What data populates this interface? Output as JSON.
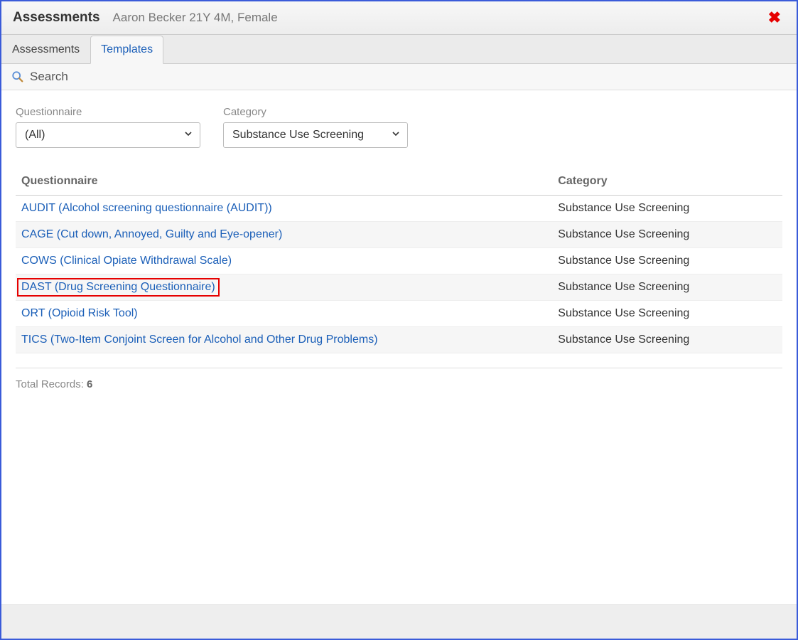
{
  "header": {
    "title": "Assessments",
    "patient": "Aaron Becker 21Y 4M, Female"
  },
  "tabs": [
    {
      "label": "Assessments",
      "active": false
    },
    {
      "label": "Templates",
      "active": true
    }
  ],
  "search_label": "Search",
  "filters": {
    "questionnaire": {
      "label": "Questionnaire",
      "value": "(All)"
    },
    "category": {
      "label": "Category",
      "value": "Substance Use Screening"
    }
  },
  "table": {
    "columns": {
      "questionnaire": "Questionnaire",
      "category": "Category"
    },
    "rows": [
      {
        "name": "AUDIT (Alcohol screening questionnaire (AUDIT))",
        "category": "Substance Use Screening",
        "highlighted": false
      },
      {
        "name": "CAGE (Cut down, Annoyed, Guilty and Eye-opener)",
        "category": "Substance Use Screening",
        "highlighted": false
      },
      {
        "name": "COWS (Clinical Opiate Withdrawal Scale)",
        "category": "Substance Use Screening",
        "highlighted": false
      },
      {
        "name": "DAST (Drug Screening Questionnaire)",
        "category": "Substance Use Screening",
        "highlighted": true
      },
      {
        "name": "ORT (Opioid Risk Tool)",
        "category": "Substance Use Screening",
        "highlighted": false
      },
      {
        "name": "TICS (Two-Item Conjoint Screen for Alcohol and Other Drug Problems)",
        "category": "Substance Use Screening",
        "highlighted": false
      }
    ]
  },
  "totals": {
    "label": "Total Records: ",
    "count": "6"
  }
}
